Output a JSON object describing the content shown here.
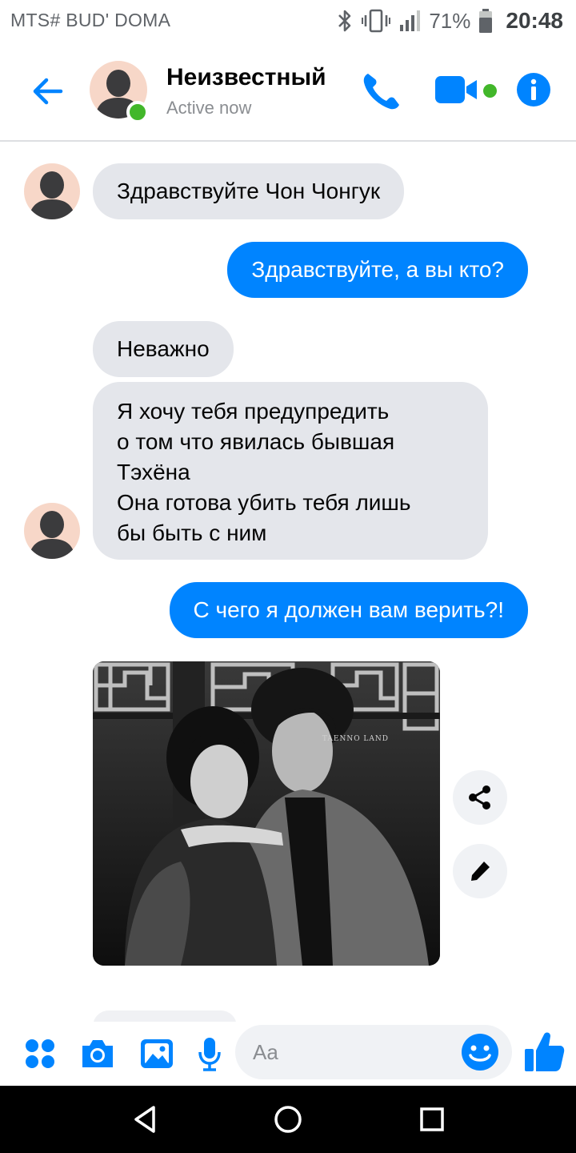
{
  "status_bar": {
    "carrier": "MTS# BUD' DOMA",
    "battery": "71%",
    "time": "20:48",
    "icons": [
      "bluetooth-icon",
      "vibrate-icon",
      "signal-icon",
      "battery-icon"
    ]
  },
  "header": {
    "contact_name": "Неизвестный",
    "status": "Active now",
    "actions": [
      "back-arrow-icon",
      "phone-icon",
      "video-camera-icon",
      "info-icon"
    ]
  },
  "messages": [
    {
      "direction": "incoming",
      "text": "Здравствуйте Чон Чонгук"
    },
    {
      "direction": "outgoing",
      "text": "Здравствуйте, а вы кто?"
    },
    {
      "direction": "incoming",
      "text": "Неважно"
    },
    {
      "direction": "incoming",
      "text": "Я хочу тебя предупредить\nо том что явилась бывшая\nТэхёна\nОна готова убить тебя лишь\nбы быть с ним"
    },
    {
      "direction": "outgoing",
      "text": "С чего я должен вам верить?!"
    },
    {
      "direction": "incoming",
      "type": "photo",
      "watermark": "TAENNO LAND"
    }
  ],
  "photo_actions": [
    "share-icon",
    "edit-pencil-icon"
  ],
  "composer": {
    "placeholder": "Aa",
    "icons": [
      "apps-grid-icon",
      "camera-icon",
      "gallery-icon",
      "microphone-icon",
      "emoji-icon",
      "thumbs-up-icon"
    ]
  },
  "nav_bar": {
    "icons": [
      "back-triangle-icon",
      "home-circle-icon",
      "recents-square-icon"
    ]
  },
  "colors": {
    "accent": "#0084ff",
    "online": "#42b72a",
    "incoming_bubble": "#e4e6eb",
    "secondary_text": "#8a8d91"
  }
}
